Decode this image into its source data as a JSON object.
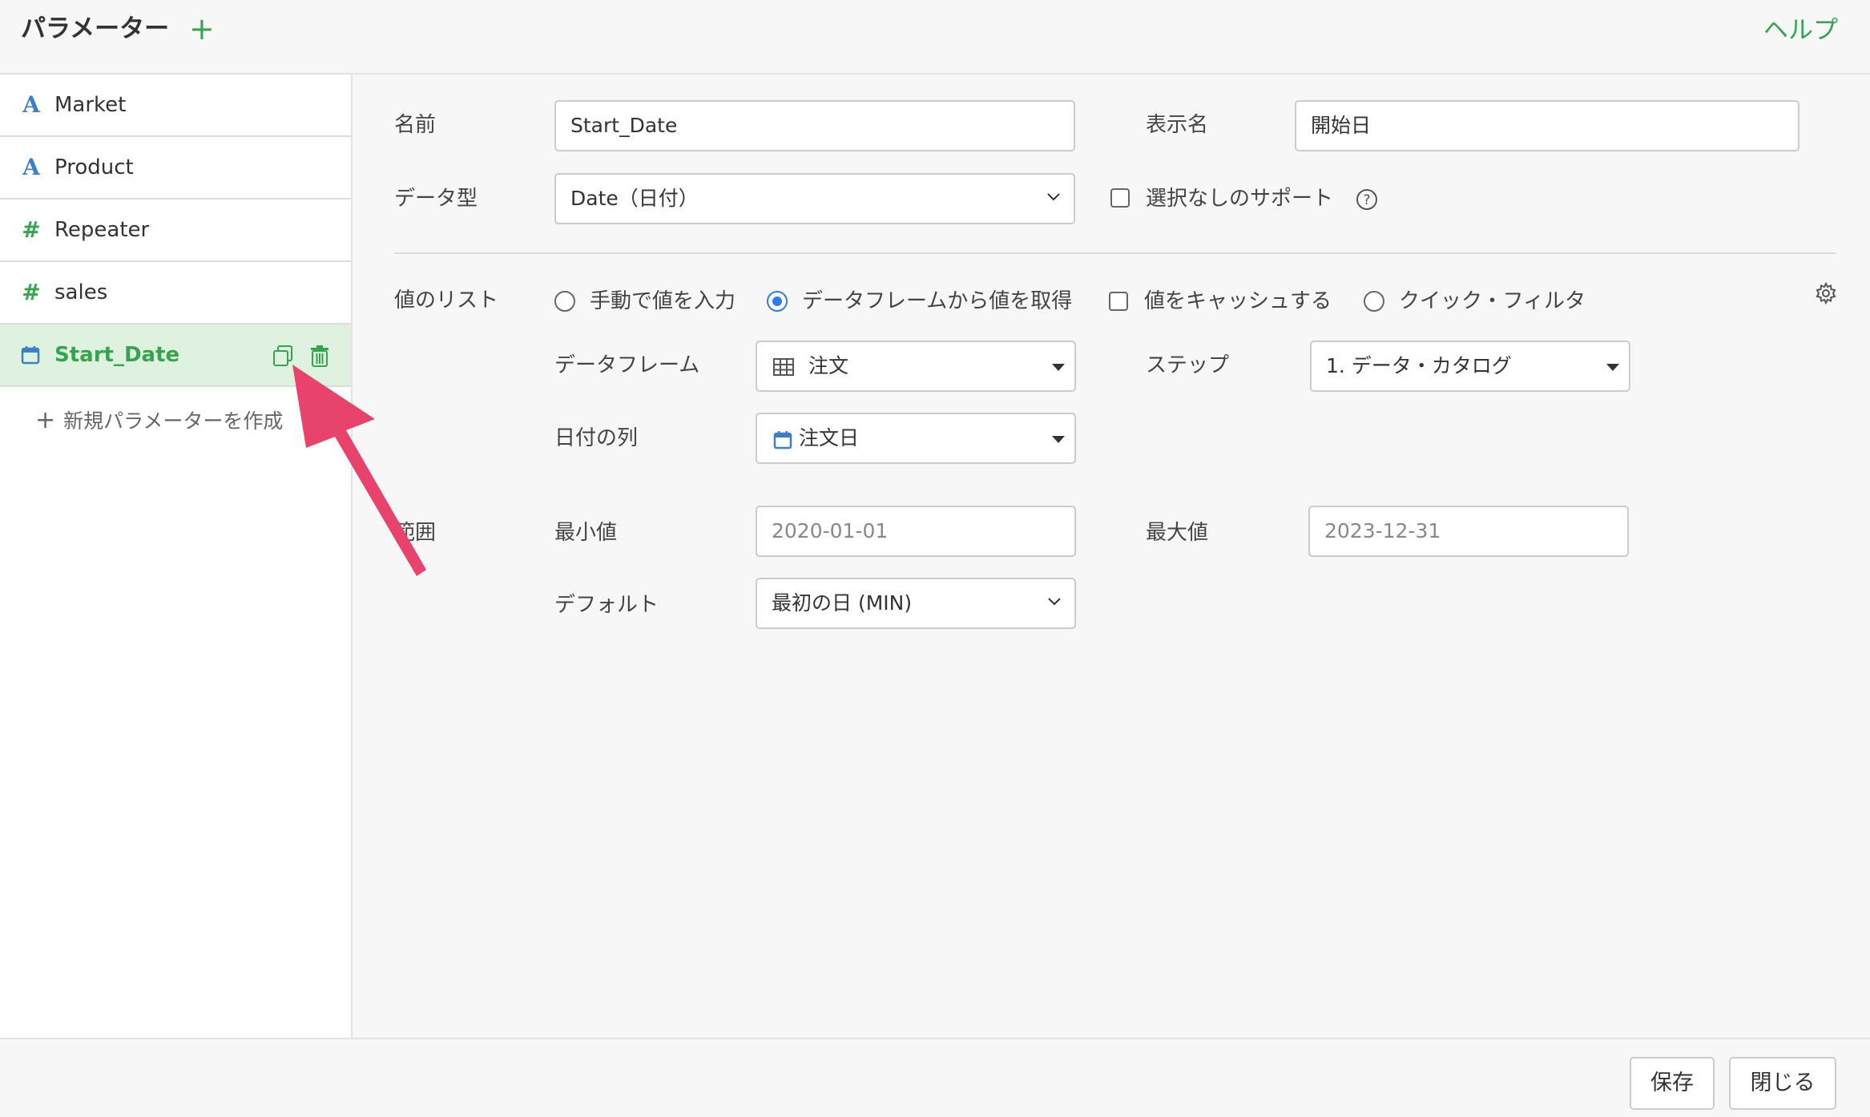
{
  "header": {
    "title": "パラメーター",
    "add_icon": "+",
    "help": "ヘルプ"
  },
  "sidebar": {
    "items": [
      {
        "label": "Market",
        "icon": "text-type-icon",
        "glyph": "A"
      },
      {
        "label": "Product",
        "icon": "text-type-icon",
        "glyph": "A"
      },
      {
        "label": "Repeater",
        "icon": "number-type-icon",
        "glyph": "#"
      },
      {
        "label": "sales",
        "icon": "number-type-icon",
        "glyph": "#"
      },
      {
        "label": "Start_Date",
        "icon": "calendar-icon",
        "active": true
      }
    ],
    "new_param_icon": "+",
    "new_param": "新規パラメーターを作成"
  },
  "form": {
    "name_label": "名前",
    "name_value": "Start_Date",
    "display_name_label": "表示名",
    "display_name_value": "開始日",
    "data_type_label": "データ型",
    "data_type_value": "Date（日付）",
    "no_selection_support": "選択なしのサポート",
    "help_icon": "?",
    "value_list_label": "値のリスト",
    "options": {
      "manual": "手動で値を入力",
      "from_dataframe": "データフレームから値を取得",
      "cache": "値をキャッシュする",
      "quick_filter": "クイック・フィルタ"
    },
    "selected_option": "from_dataframe",
    "dataframe_label": "データフレーム",
    "dataframe_value": "注文",
    "step_label": "ステップ",
    "step_value": "1. データ・カタログ",
    "date_column_label": "日付の列",
    "date_column_value": "注文日",
    "range_label": "範囲",
    "min_label": "最小値",
    "min_value": "2020-01-01",
    "max_label": "最大値",
    "max_value": "2023-12-31",
    "default_label": "デフォルト",
    "default_value": "最初の日 (MIN)"
  },
  "footer": {
    "save": "保存",
    "close": "閉じる"
  },
  "colors": {
    "accent": "#35a44e",
    "link_blue": "#3b7fc4",
    "radio_blue": "#2f7bea",
    "arrow": "#e8436c"
  }
}
